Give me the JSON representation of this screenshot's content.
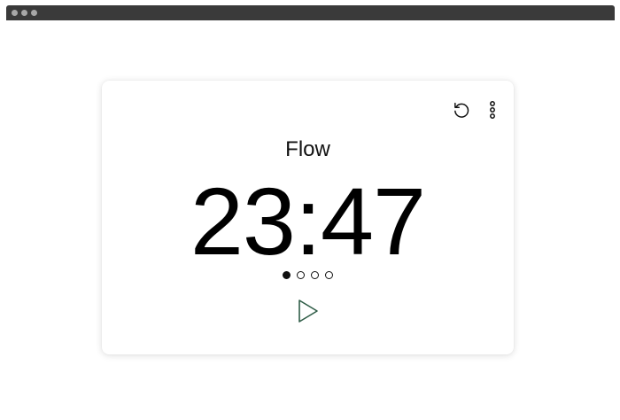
{
  "timer": {
    "label": "Flow",
    "time": "23:47",
    "sessions_total": 4,
    "sessions_completed": 1
  },
  "toolbar": {
    "reset_icon": "reset-icon",
    "more_icon": "more-vertical-icon"
  },
  "controls": {
    "play_icon": "play-icon"
  },
  "colors": {
    "accent": "#2f5d47",
    "titlebar": "#3a3a3a"
  }
}
